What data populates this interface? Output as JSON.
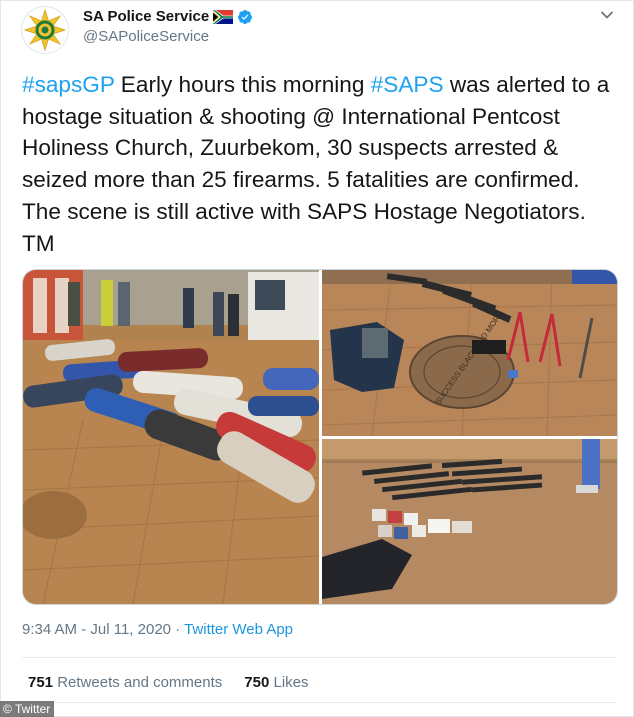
{
  "tweet": {
    "display_name": "SA Police Service",
    "handle": "@SAPoliceService",
    "avatar_icon": "saps-star-emblem",
    "flag_icon": "south-africa-flag",
    "verified_icon": "verified-badge",
    "verified_color": "#1da1f2",
    "menu_icon": "chevron-down",
    "text": {
      "hashtag_1": "#sapsGP",
      "part_1": " Early hours this morning ",
      "hashtag_2": "#SAPS",
      "part_2": " was alerted to a hostage situation & shooting @ International Pentcost Holiness Church, Zuurbekom, 30 suspects arrested & seized more than 25 firearms. 5 fatalities are confirmed. The scene is still active with SAPS Hostage Negotiators. TM"
    },
    "link_color": "#1da1f2",
    "media": {
      "manhole_text": "SUCCESS BLACK AND MORE",
      "photos": [
        "suspects-lying-on-ground-photo",
        "seized-items-on-paving-photo",
        "seized-firearms-and-ammunition-photo"
      ]
    },
    "time": "9:34 AM",
    "date": "Jul 11, 2020",
    "separator": " · ",
    "dash": " - ",
    "source": "Twitter Web App",
    "retweets_count": "751",
    "retweets_label": "Retweets and comments",
    "likes_count": "750",
    "likes_label": "Likes"
  },
  "watermark": "© Twitter"
}
